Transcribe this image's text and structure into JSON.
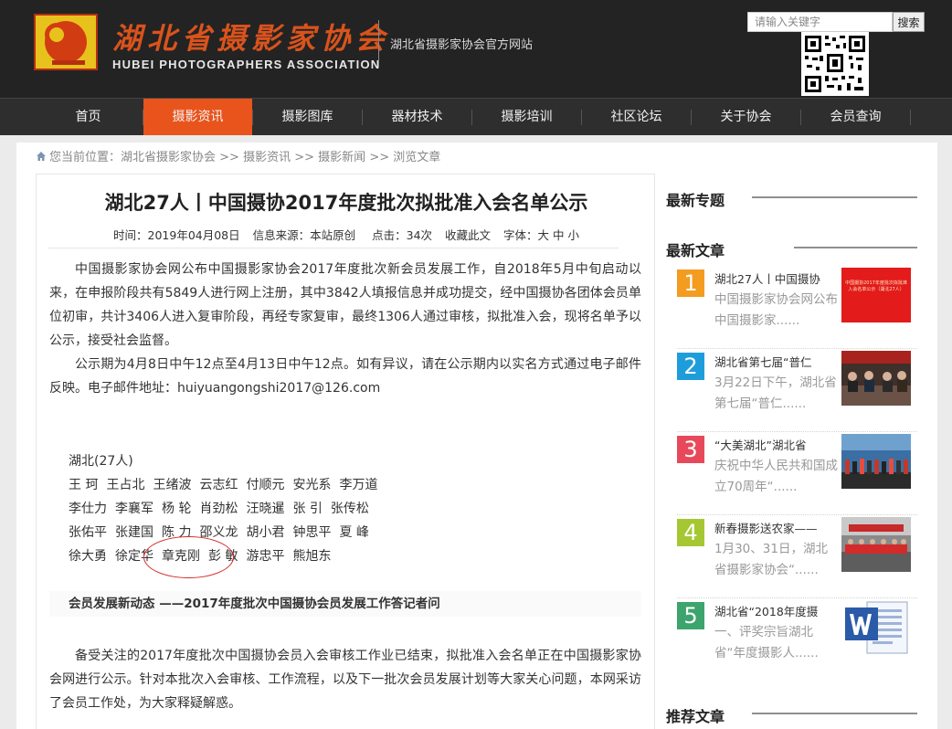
{
  "header": {
    "logo_cn": "湖北省摄影家协会",
    "logo_en": "HUBEI PHOTOGRAPHERS ASSOCIATION",
    "slogan": "湖北省摄影家协会官方网站",
    "search_placeholder": "请输入关键字",
    "search_button": "搜索"
  },
  "nav": {
    "items": [
      "首页",
      "摄影资讯",
      "摄影图库",
      "器材技术",
      "摄影培训",
      "社区论坛",
      "关于协会",
      "会员查询"
    ],
    "active_index": 1
  },
  "breadcrumb": {
    "prefix": "您当前位置：",
    "items": [
      "湖北省摄影家协会",
      "摄影资讯",
      "摄影新闻",
      "浏览文章"
    ],
    "separator": " >> "
  },
  "article": {
    "title": "湖北27人丨中国摄协2017年度批次拟批准入会名单公示",
    "meta": {
      "time": "时间：2019年04月08日",
      "source": "信息来源：本站原创",
      "clicks": "点击：34次",
      "favorite": "收藏此文",
      "font": "字体：大 中 小"
    },
    "paragraphs": [
      "中国摄影家协会网公布中国摄影家协会2017年度批次新会员发展工作，自2018年5月中旬启动以来，在申报阶段共有5849人进行网上注册，其中3842人填报信息并成功提交，经中国摄协各团体会员单位初审，共计3406人进入复审阶段，再经专家复审，最终1306人通过审核，拟批准入会，现将名单予以公示，接受社会监督。",
      "公示期为4月8日中午12点至4月13日中午12点。如有异议，请在公示期内以实名方式通过电子邮件反映。电子邮件地址：huiyuangongshi2017@126.com"
    ],
    "group_title": "湖北(27人)",
    "name_rows": [
      [
        "王  珂",
        "王占北",
        "王绪波",
        "云志红",
        "付顺元",
        "安光系",
        "李万道"
      ],
      [
        "李仕力",
        "李襄军",
        "杨  轮",
        "肖劲松",
        "汪晓暹",
        "张  引",
        "张传松"
      ],
      [
        "张佑平",
        "张建国",
        "陈  力",
        "邵义龙",
        "胡小君",
        "钟思平",
        "夏  峰"
      ],
      [
        "徐大勇",
        "徐定华",
        "章克刚",
        "彭  敏",
        "游忠平",
        "熊旭东"
      ]
    ],
    "news_head": "会员发展新动态 ——2017年度批次中国摄协会员发展工作答记者问",
    "closing_paragraph": "备受关注的2017年度批次中国摄协会员入会审核工作业已结束，拟批准入会名单正在中国摄影家协会网进行公示。针对本批次入会审核、工作流程，以及下一批次会员发展计划等大家关心问题，本网采访了会员工作处，为大家释疑解惑。"
  },
  "sidebar": {
    "latest_topics": "最新专题",
    "latest_articles": "最新文章",
    "recommended": "推荐文章",
    "items": [
      {
        "num": "1",
        "color": "#f39c1f",
        "title": "湖北27人丨中国摄协",
        "desc": "中国摄影家协会网公布中国摄影家......",
        "thumb_text": "中国摄协2017年度批次拟批准入会名单公示（湖北27人）"
      },
      {
        "num": "2",
        "color": "#1f9ddb",
        "title": "湖北省第七届“普仁",
        "desc": "3月22日下午，湖北省第七届“普仁......"
      },
      {
        "num": "3",
        "color": "#e8495a",
        "title": "“大美湖北”湖北省",
        "desc": "庆祝中华人民共和国成立70周年“......"
      },
      {
        "num": "4",
        "color": "#a5c832",
        "title": "新春摄影送农家——",
        "desc": " 1月30、31日，湖北省摄影家协会“......"
      },
      {
        "num": "5",
        "color": "#3ca46c",
        "title": "湖北省“2018年度摄",
        "desc": "一、评奖宗旨湖北省“年度摄影人......"
      }
    ]
  }
}
